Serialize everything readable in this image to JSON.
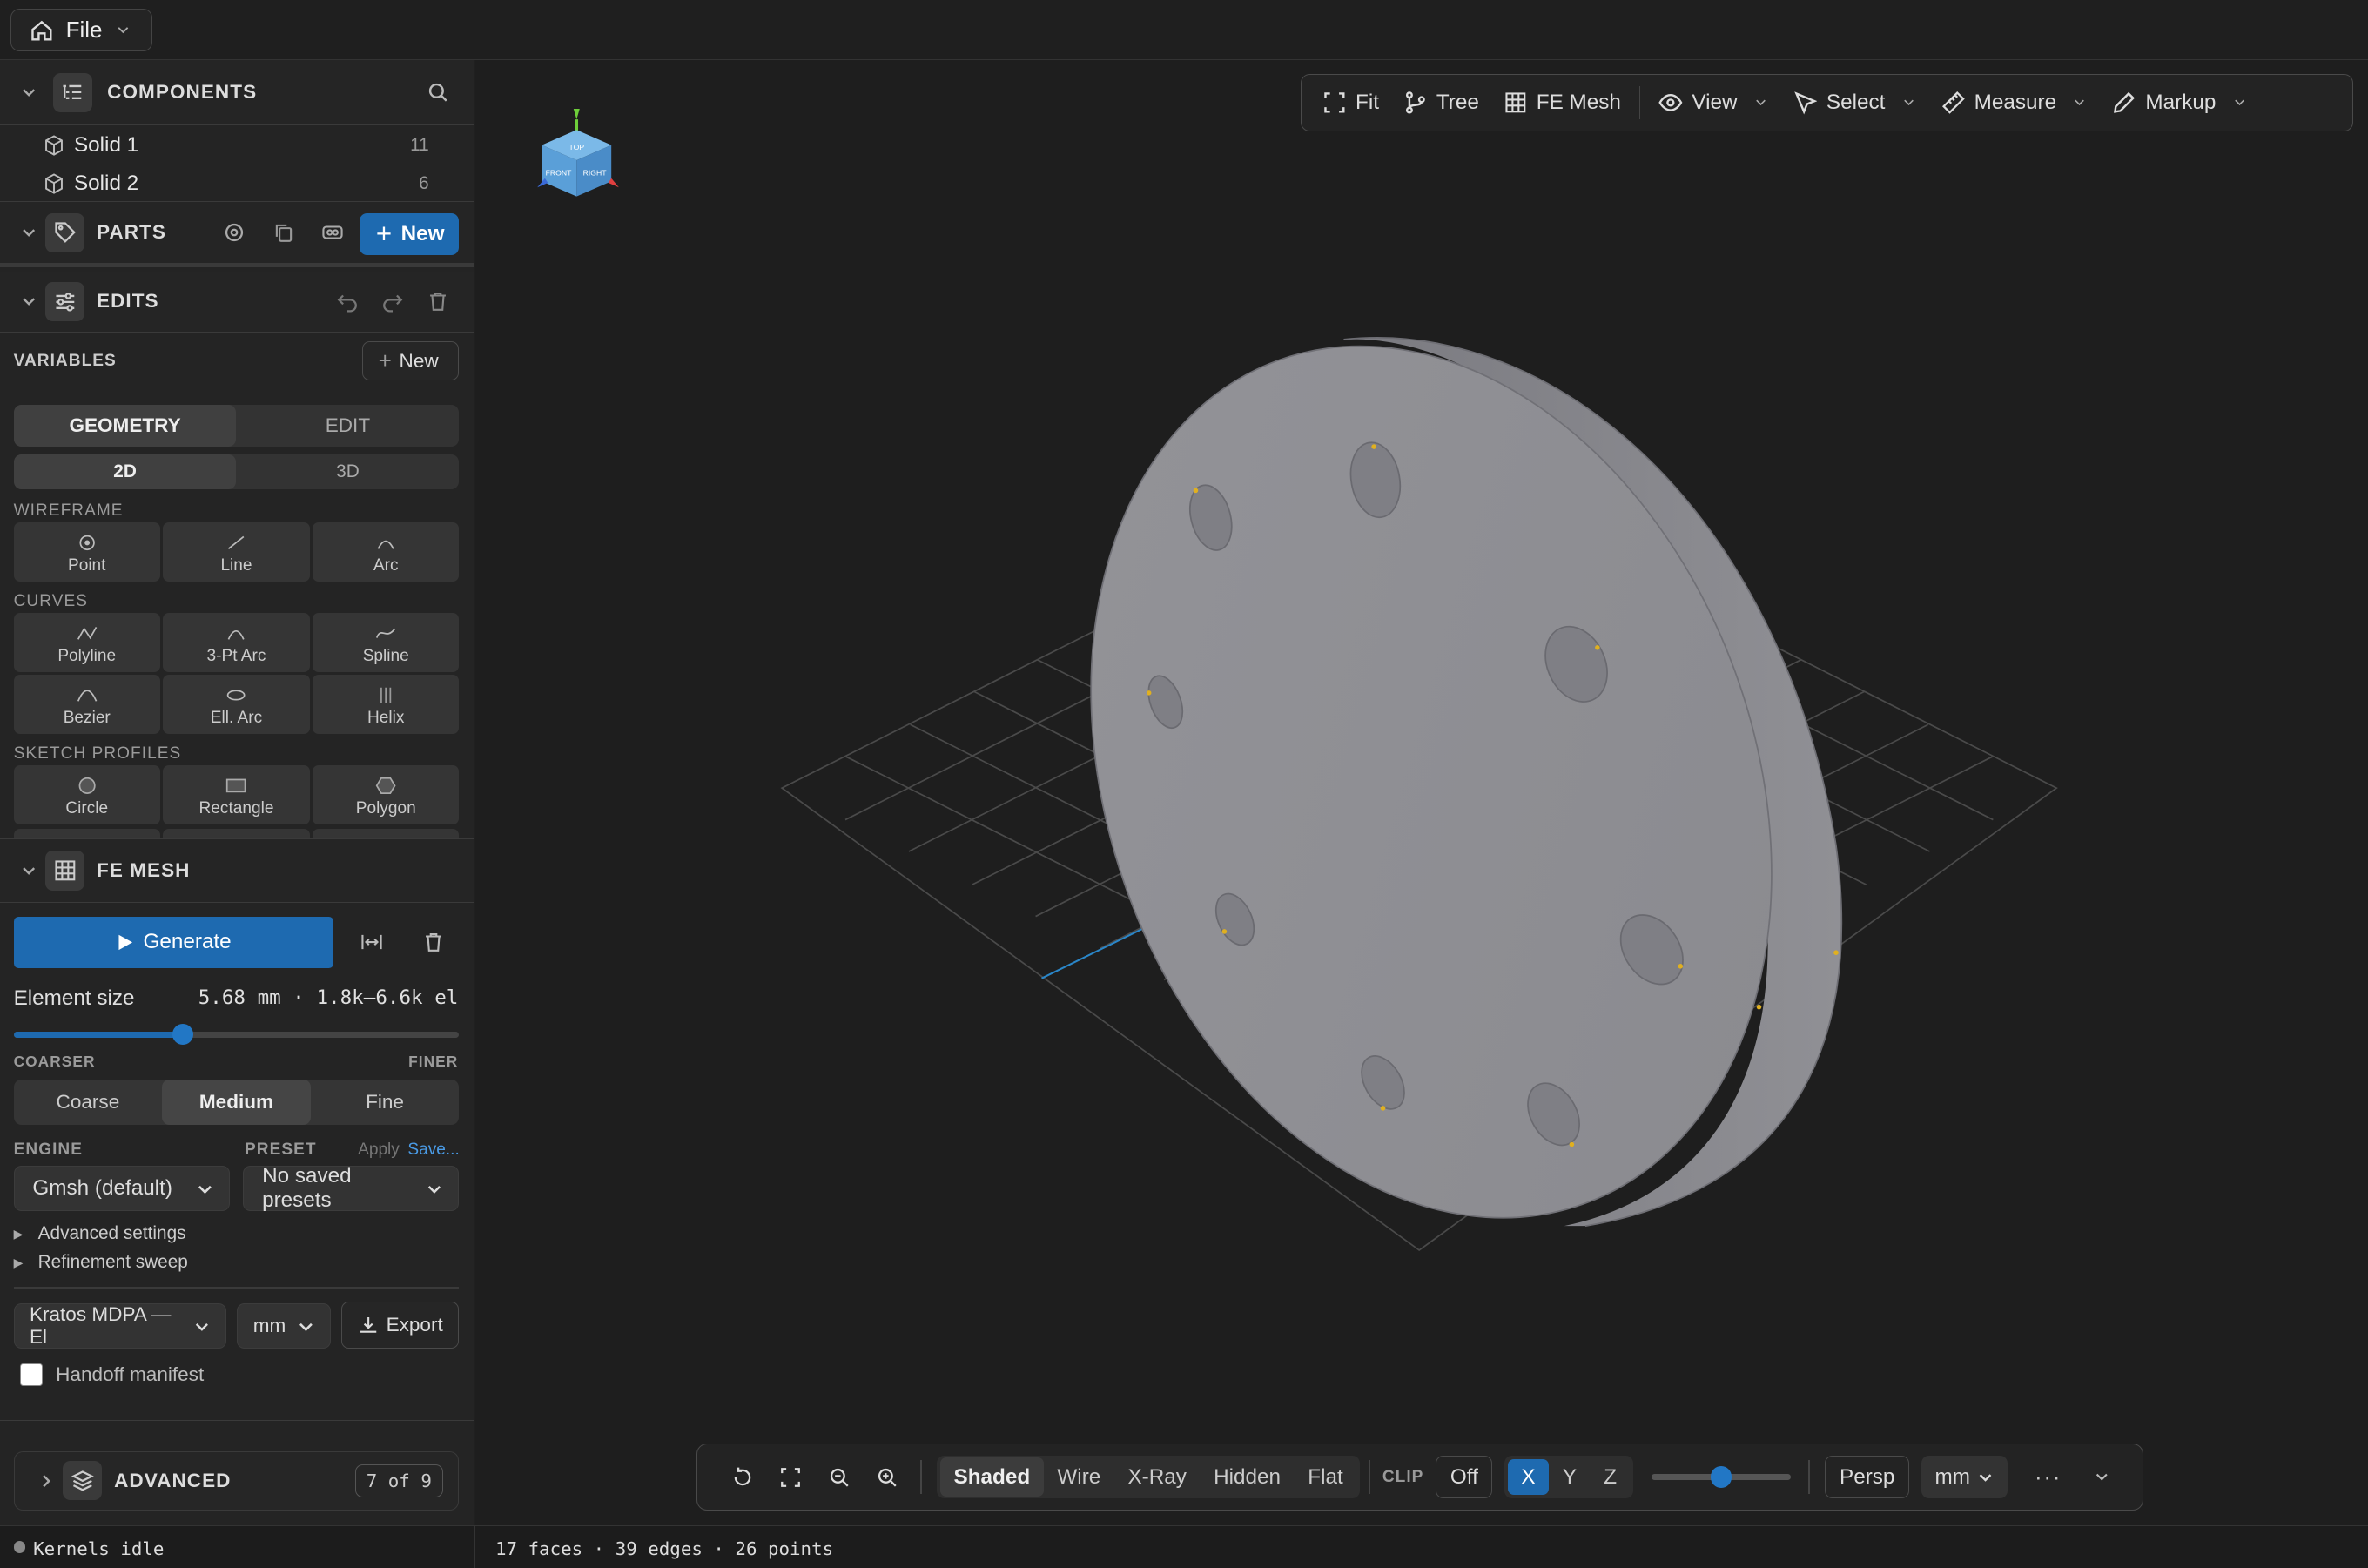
{
  "topbar": {
    "file_label": "File"
  },
  "components": {
    "title": "COMPONENTS",
    "items": [
      {
        "label": "Solid 1",
        "count": "11"
      },
      {
        "label": "Solid 2",
        "count": "6"
      }
    ]
  },
  "parts": {
    "title": "PARTS",
    "new_label": "New"
  },
  "edits": {
    "title": "EDITS"
  },
  "variables": {
    "title": "VARIABLES",
    "new_label": "New"
  },
  "geometry": {
    "tabs": [
      "GEOMETRY",
      "EDIT"
    ],
    "dim_tabs": [
      "2D",
      "3D"
    ],
    "wireframe_label": "WIREFRAME",
    "wireframe": [
      "Point",
      "Line",
      "Arc"
    ],
    "curves_label": "CURVES",
    "curves": [
      "Polyline",
      "3-Pt Arc",
      "Spline",
      "Bezier",
      "Ell. Arc",
      "Helix"
    ],
    "sketch_label": "SKETCH PROFILES",
    "sketch": [
      "Circle",
      "Rectangle",
      "Polygon"
    ]
  },
  "femesh": {
    "title": "FE MESH",
    "generate_label": "Generate",
    "element_size_label": "Element size",
    "element_size_value": "5.68 mm · 1.8k–6.6k el",
    "slider_fraction": 0.38,
    "coarser_label": "COARSER",
    "finer_label": "FINER",
    "density": [
      "Coarse",
      "Medium",
      "Fine"
    ],
    "engine_label": "ENGINE",
    "engine_value": "Gmsh (default)",
    "preset_label": "PRESET",
    "apply_label": "Apply",
    "save_label": "Save...",
    "preset_value": "No saved presets",
    "advanced_settings": "Advanced settings",
    "refinement_sweep": "Refinement sweep",
    "format_value": "Kratos MDPA — El",
    "unit_value": "mm",
    "export_label": "Export",
    "handoff_label": "Handoff manifest"
  },
  "advanced": {
    "title": "ADVANCED",
    "badge": "7 of 9"
  },
  "view_toolbar": {
    "fit": "Fit",
    "tree": "Tree",
    "fe_mesh": "FE Mesh",
    "view": "View",
    "select": "Select",
    "measure": "Measure",
    "markup": "Markup"
  },
  "bottom_toolbar": {
    "modes": [
      "Shaded",
      "Wire",
      "X-Ray",
      "Hidden",
      "Flat"
    ],
    "clip_label": "CLIP",
    "clip_off": "Off",
    "axes": [
      "X",
      "Y",
      "Z"
    ],
    "clip_fraction": 0.5,
    "projection": "Persp",
    "unit": "mm",
    "more": "···"
  },
  "status": {
    "kernel": "Kernels idle",
    "stats": "17 faces · 39 edges · 26 points"
  },
  "viewcube": {
    "faces": [
      "TOP",
      "FRONT",
      "RIGHT"
    ]
  },
  "colors": {
    "accent": "#1e6ab0",
    "model": "#8e8e93",
    "grid": "#4a4a4a"
  }
}
